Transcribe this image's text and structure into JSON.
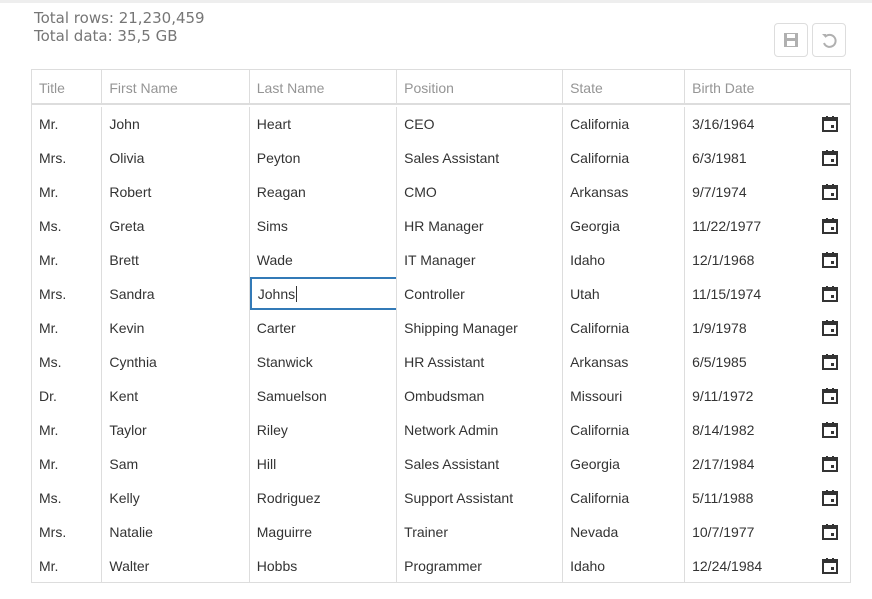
{
  "stats": {
    "total_rows": "Total rows: 21,230,459",
    "total_data": "Total data: 35,5 GB"
  },
  "toolbar": {
    "save_icon": "save-icon",
    "revert_icon": "undo-icon"
  },
  "columns": [
    "Title",
    "First Name",
    "Last Name",
    "Position",
    "State",
    "Birth Date"
  ],
  "rows": [
    [
      "Mr.",
      "John",
      "Heart",
      "CEO",
      "California",
      "3/16/1964"
    ],
    [
      "Mrs.",
      "Olivia",
      "Peyton",
      "Sales Assistant",
      "California",
      "6/3/1981"
    ],
    [
      "Mr.",
      "Robert",
      "Reagan",
      "CMO",
      "Arkansas",
      "9/7/1974"
    ],
    [
      "Ms.",
      "Greta",
      "Sims",
      "HR Manager",
      "Georgia",
      "11/22/1977"
    ],
    [
      "Mr.",
      "Brett",
      "Wade",
      "IT Manager",
      "Idaho",
      "12/1/1968"
    ],
    [
      "Mrs.",
      "Sandra",
      "Johns",
      "Controller",
      "Utah",
      "11/15/1974"
    ],
    [
      "Mr.",
      "Kevin",
      "Carter",
      "Shipping Manager",
      "California",
      "1/9/1978"
    ],
    [
      "Ms.",
      "Cynthia",
      "Stanwick",
      "HR Assistant",
      "Arkansas",
      "6/5/1985"
    ],
    [
      "Dr.",
      "Kent",
      "Samuelson",
      "Ombudsman",
      "Missouri",
      "9/11/1972"
    ],
    [
      "Mr.",
      "Taylor",
      "Riley",
      "Network Admin",
      "California",
      "8/14/1982"
    ],
    [
      "Mr.",
      "Sam",
      "Hill",
      "Sales Assistant",
      "Georgia",
      "2/17/1984"
    ],
    [
      "Ms.",
      "Kelly",
      "Rodriguez",
      "Support Assistant",
      "California",
      "5/11/1988"
    ],
    [
      "Mrs.",
      "Natalie",
      "Maguirre",
      "Trainer",
      "Nevada",
      "10/7/1977"
    ],
    [
      "Mr.",
      "Walter",
      "Hobbs",
      "Programmer",
      "Idaho",
      "12/24/1984"
    ]
  ],
  "editing": {
    "row": 5,
    "col": 2
  },
  "colors": {
    "accent": "#337ab7",
    "border": "#dddddd",
    "header_text": "#959595"
  }
}
